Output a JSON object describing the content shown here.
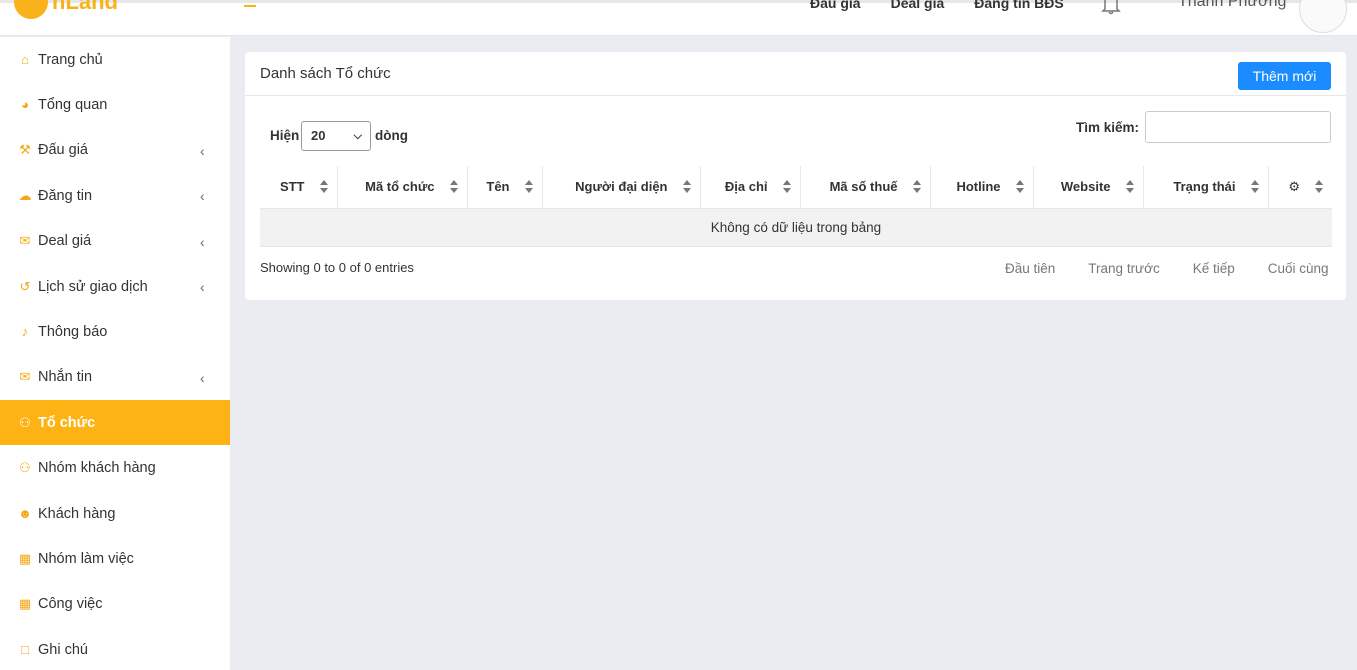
{
  "header": {
    "logo_text": "nLand",
    "nav": [
      "Đấu giá",
      "Deal giá",
      "Đăng tin BĐS"
    ],
    "user_name": "Thanh Phương"
  },
  "sidebar": {
    "items": [
      {
        "label": "Trang chủ",
        "icon": "home-icon",
        "has_arrow": false,
        "active": false
      },
      {
        "label": "Tổng quan",
        "icon": "dashboard-icon",
        "has_arrow": false,
        "active": false
      },
      {
        "label": "Đấu giá",
        "icon": "gavel-icon",
        "has_arrow": true,
        "active": false
      },
      {
        "label": "Đăng tin",
        "icon": "cloud-upload-icon",
        "has_arrow": true,
        "active": false
      },
      {
        "label": "Deal giá",
        "icon": "envelope-icon",
        "has_arrow": true,
        "active": false
      },
      {
        "label": "Lịch sử giao dịch",
        "icon": "history-icon",
        "has_arrow": true,
        "active": false
      },
      {
        "label": "Thông báo",
        "icon": "bell-icon",
        "has_arrow": false,
        "active": false
      },
      {
        "label": "Nhắn tin",
        "icon": "envelope-icon",
        "has_arrow": true,
        "active": false
      },
      {
        "label": "Tổ chức",
        "icon": "users-icon",
        "has_arrow": false,
        "active": true
      },
      {
        "label": "Nhóm khách hàng",
        "icon": "users-icon",
        "has_arrow": false,
        "active": false
      },
      {
        "label": "Khách hàng",
        "icon": "user-icon",
        "has_arrow": false,
        "active": false
      },
      {
        "label": "Nhóm làm việc",
        "icon": "calendar-icon",
        "has_arrow": false,
        "active": false
      },
      {
        "label": "Công việc",
        "icon": "calendar-icon",
        "has_arrow": false,
        "active": false
      },
      {
        "label": "Ghi chú",
        "icon": "note-icon",
        "has_arrow": false,
        "active": false
      }
    ]
  },
  "card": {
    "title": "Danh sách Tổ chức",
    "add_button": "Thêm mới",
    "length_label": "Hiện",
    "length_value": "20",
    "length_suffix": "dòng",
    "search_label": "Tìm kiếm:",
    "search_value": ""
  },
  "table": {
    "columns": [
      "STT",
      "Mã tổ chức",
      "Tên",
      "Người đại diện",
      "Địa chỉ",
      "Mã số thuế",
      "Hotline",
      "Website",
      "Trạng thái"
    ],
    "settings_icon": "gear-icon",
    "empty_text": "Không có dữ liệu trong bảng"
  },
  "footer": {
    "info": "Showing 0 to 0 of 0 entries",
    "pager": [
      "Đầu tiên",
      "Trang trước",
      "Kế tiếp",
      "Cuối cùng"
    ]
  },
  "colors": {
    "accent": "#fdb313",
    "primary_button": "#1a8cff",
    "page_bg": "#eaecf1"
  }
}
